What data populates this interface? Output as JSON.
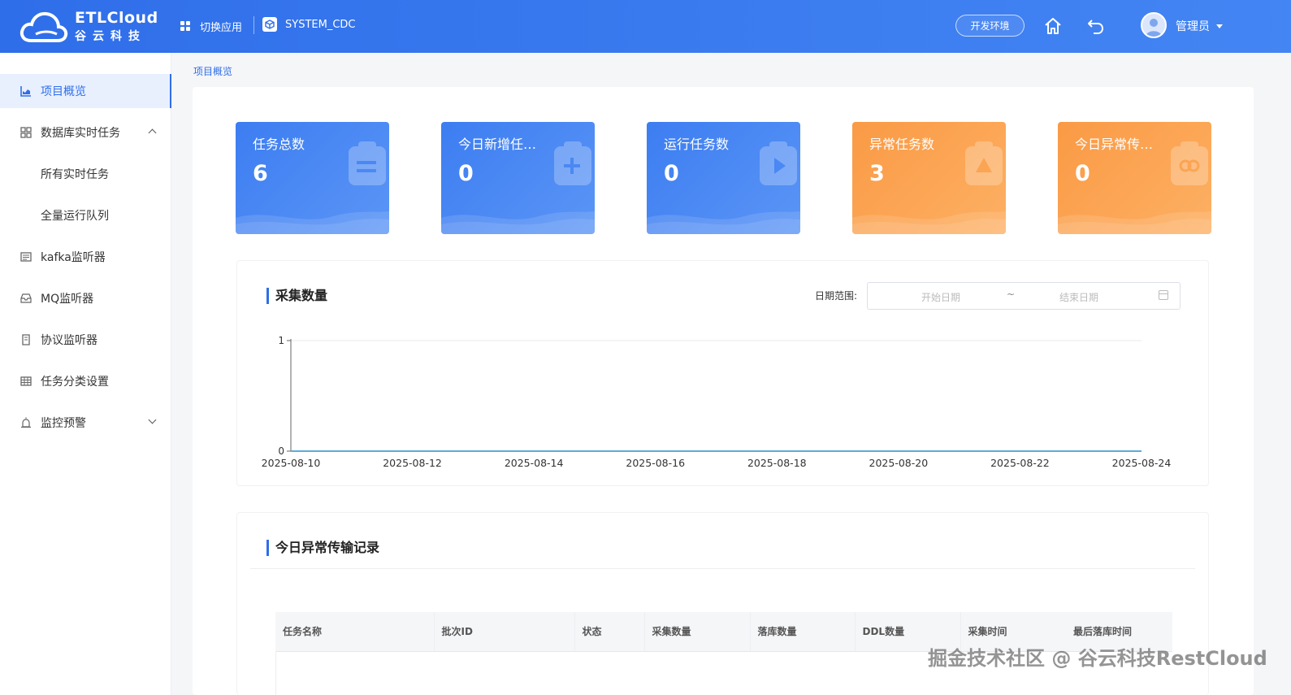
{
  "header": {
    "brand": "ETLCloud",
    "brand_sub": "谷云科技",
    "switch_app_label": "切换应用",
    "system_name": "SYSTEM_CDC",
    "env_label": "开发环境",
    "user_name": "管理员"
  },
  "sidebar": {
    "items": [
      {
        "label": "项目概览",
        "icon": "chart-icon",
        "active": true
      },
      {
        "label": "数据库实时任务",
        "icon": "grid-icon",
        "expanded": true
      },
      {
        "label": "所有实时任务",
        "sub": true
      },
      {
        "label": "全量运行队列",
        "sub": true
      },
      {
        "label": "kafka监听器",
        "icon": "list-icon"
      },
      {
        "label": "MQ监听器",
        "icon": "inbox-icon"
      },
      {
        "label": "协议监听器",
        "icon": "document-icon"
      },
      {
        "label": "任务分类设置",
        "icon": "table-icon"
      },
      {
        "label": "监控预警",
        "icon": "alarm-icon",
        "expandable": true
      }
    ]
  },
  "breadcrumb": "项目概览",
  "stats": [
    {
      "label": "任务总数",
      "value": "6",
      "color": "blue",
      "icon": "clipboard-list-icon"
    },
    {
      "label": "今日新增任…",
      "value": "0",
      "color": "blue",
      "icon": "clipboard-add-icon"
    },
    {
      "label": "运行任务数",
      "value": "0",
      "color": "blue",
      "icon": "clipboard-play-icon"
    },
    {
      "label": "异常任务数",
      "value": "3",
      "color": "orange",
      "icon": "clipboard-warning-icon"
    },
    {
      "label": "今日异常传…",
      "value": "0",
      "color": "orange",
      "icon": "clipboard-link-icon"
    }
  ],
  "collect_section": {
    "title": "采集数量",
    "date_label": "日期范围:",
    "start_placeholder": "开始日期",
    "separator": "~",
    "end_placeholder": "结束日期"
  },
  "chart_data": {
    "type": "line",
    "x": [
      "2025-08-10",
      "2025-08-11",
      "2025-08-12",
      "2025-08-13",
      "2025-08-14",
      "2025-08-15",
      "2025-08-16",
      "2025-08-17",
      "2025-08-18",
      "2025-08-19",
      "2025-08-20",
      "2025-08-21",
      "2025-08-22",
      "2025-08-23",
      "2025-08-24"
    ],
    "x_tick_labels": [
      "2025-08-10",
      "2025-08-12",
      "2025-08-14",
      "2025-08-16",
      "2025-08-18",
      "2025-08-20",
      "2025-08-22",
      "2025-08-24"
    ],
    "series": [
      {
        "values": [
          0,
          0,
          0,
          0,
          0,
          0,
          0,
          0,
          0,
          0,
          0,
          0,
          0,
          0,
          0
        ]
      }
    ],
    "y_tick_labels": [
      "0",
      "1"
    ],
    "ylim": [
      0,
      1
    ],
    "line_color": "#5aaed8",
    "grid": true,
    "title": "",
    "xlabel": "",
    "ylabel": ""
  },
  "error_section": {
    "title": "今日异常传输记录",
    "columns": [
      "任务名称",
      "批次ID",
      "状态",
      "采集数量",
      "落库数量",
      "DDL数量",
      "采集时间",
      "最后落库时间"
    ]
  },
  "watermark": "掘金技术社区 @ 谷云科技RestCloud"
}
